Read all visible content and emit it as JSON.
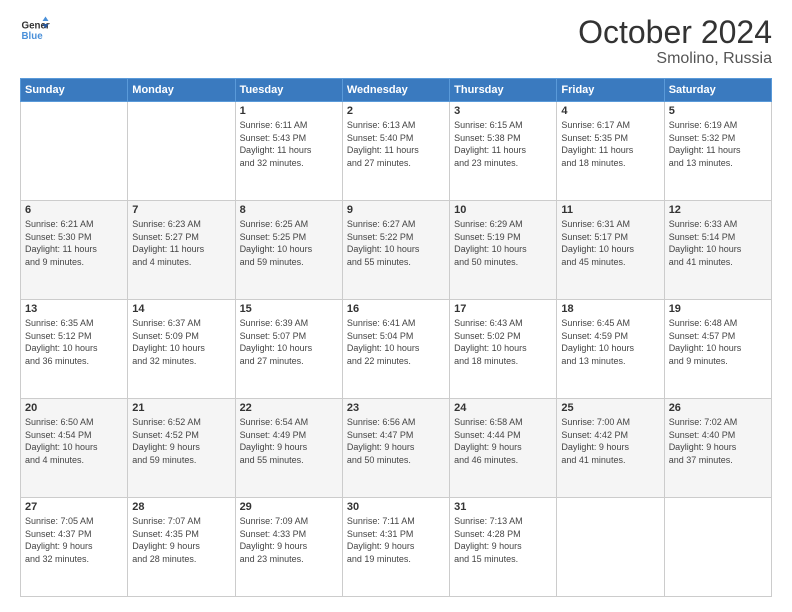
{
  "logo": {
    "line1": "General",
    "line2": "Blue"
  },
  "title": "October 2024",
  "location": "Smolino, Russia",
  "days_header": [
    "Sunday",
    "Monday",
    "Tuesday",
    "Wednesday",
    "Thursday",
    "Friday",
    "Saturday"
  ],
  "weeks": [
    [
      {
        "day": "",
        "info": ""
      },
      {
        "day": "",
        "info": ""
      },
      {
        "day": "1",
        "info": "Sunrise: 6:11 AM\nSunset: 5:43 PM\nDaylight: 11 hours\nand 32 minutes."
      },
      {
        "day": "2",
        "info": "Sunrise: 6:13 AM\nSunset: 5:40 PM\nDaylight: 11 hours\nand 27 minutes."
      },
      {
        "day": "3",
        "info": "Sunrise: 6:15 AM\nSunset: 5:38 PM\nDaylight: 11 hours\nand 23 minutes."
      },
      {
        "day": "4",
        "info": "Sunrise: 6:17 AM\nSunset: 5:35 PM\nDaylight: 11 hours\nand 18 minutes."
      },
      {
        "day": "5",
        "info": "Sunrise: 6:19 AM\nSunset: 5:32 PM\nDaylight: 11 hours\nand 13 minutes."
      }
    ],
    [
      {
        "day": "6",
        "info": "Sunrise: 6:21 AM\nSunset: 5:30 PM\nDaylight: 11 hours\nand 9 minutes."
      },
      {
        "day": "7",
        "info": "Sunrise: 6:23 AM\nSunset: 5:27 PM\nDaylight: 11 hours\nand 4 minutes."
      },
      {
        "day": "8",
        "info": "Sunrise: 6:25 AM\nSunset: 5:25 PM\nDaylight: 10 hours\nand 59 minutes."
      },
      {
        "day": "9",
        "info": "Sunrise: 6:27 AM\nSunset: 5:22 PM\nDaylight: 10 hours\nand 55 minutes."
      },
      {
        "day": "10",
        "info": "Sunrise: 6:29 AM\nSunset: 5:19 PM\nDaylight: 10 hours\nand 50 minutes."
      },
      {
        "day": "11",
        "info": "Sunrise: 6:31 AM\nSunset: 5:17 PM\nDaylight: 10 hours\nand 45 minutes."
      },
      {
        "day": "12",
        "info": "Sunrise: 6:33 AM\nSunset: 5:14 PM\nDaylight: 10 hours\nand 41 minutes."
      }
    ],
    [
      {
        "day": "13",
        "info": "Sunrise: 6:35 AM\nSunset: 5:12 PM\nDaylight: 10 hours\nand 36 minutes."
      },
      {
        "day": "14",
        "info": "Sunrise: 6:37 AM\nSunset: 5:09 PM\nDaylight: 10 hours\nand 32 minutes."
      },
      {
        "day": "15",
        "info": "Sunrise: 6:39 AM\nSunset: 5:07 PM\nDaylight: 10 hours\nand 27 minutes."
      },
      {
        "day": "16",
        "info": "Sunrise: 6:41 AM\nSunset: 5:04 PM\nDaylight: 10 hours\nand 22 minutes."
      },
      {
        "day": "17",
        "info": "Sunrise: 6:43 AM\nSunset: 5:02 PM\nDaylight: 10 hours\nand 18 minutes."
      },
      {
        "day": "18",
        "info": "Sunrise: 6:45 AM\nSunset: 4:59 PM\nDaylight: 10 hours\nand 13 minutes."
      },
      {
        "day": "19",
        "info": "Sunrise: 6:48 AM\nSunset: 4:57 PM\nDaylight: 10 hours\nand 9 minutes."
      }
    ],
    [
      {
        "day": "20",
        "info": "Sunrise: 6:50 AM\nSunset: 4:54 PM\nDaylight: 10 hours\nand 4 minutes."
      },
      {
        "day": "21",
        "info": "Sunrise: 6:52 AM\nSunset: 4:52 PM\nDaylight: 9 hours\nand 59 minutes."
      },
      {
        "day": "22",
        "info": "Sunrise: 6:54 AM\nSunset: 4:49 PM\nDaylight: 9 hours\nand 55 minutes."
      },
      {
        "day": "23",
        "info": "Sunrise: 6:56 AM\nSunset: 4:47 PM\nDaylight: 9 hours\nand 50 minutes."
      },
      {
        "day": "24",
        "info": "Sunrise: 6:58 AM\nSunset: 4:44 PM\nDaylight: 9 hours\nand 46 minutes."
      },
      {
        "day": "25",
        "info": "Sunrise: 7:00 AM\nSunset: 4:42 PM\nDaylight: 9 hours\nand 41 minutes."
      },
      {
        "day": "26",
        "info": "Sunrise: 7:02 AM\nSunset: 4:40 PM\nDaylight: 9 hours\nand 37 minutes."
      }
    ],
    [
      {
        "day": "27",
        "info": "Sunrise: 7:05 AM\nSunset: 4:37 PM\nDaylight: 9 hours\nand 32 minutes."
      },
      {
        "day": "28",
        "info": "Sunrise: 7:07 AM\nSunset: 4:35 PM\nDaylight: 9 hours\nand 28 minutes."
      },
      {
        "day": "29",
        "info": "Sunrise: 7:09 AM\nSunset: 4:33 PM\nDaylight: 9 hours\nand 23 minutes."
      },
      {
        "day": "30",
        "info": "Sunrise: 7:11 AM\nSunset: 4:31 PM\nDaylight: 9 hours\nand 19 minutes."
      },
      {
        "day": "31",
        "info": "Sunrise: 7:13 AM\nSunset: 4:28 PM\nDaylight: 9 hours\nand 15 minutes."
      },
      {
        "day": "",
        "info": ""
      },
      {
        "day": "",
        "info": ""
      }
    ]
  ]
}
